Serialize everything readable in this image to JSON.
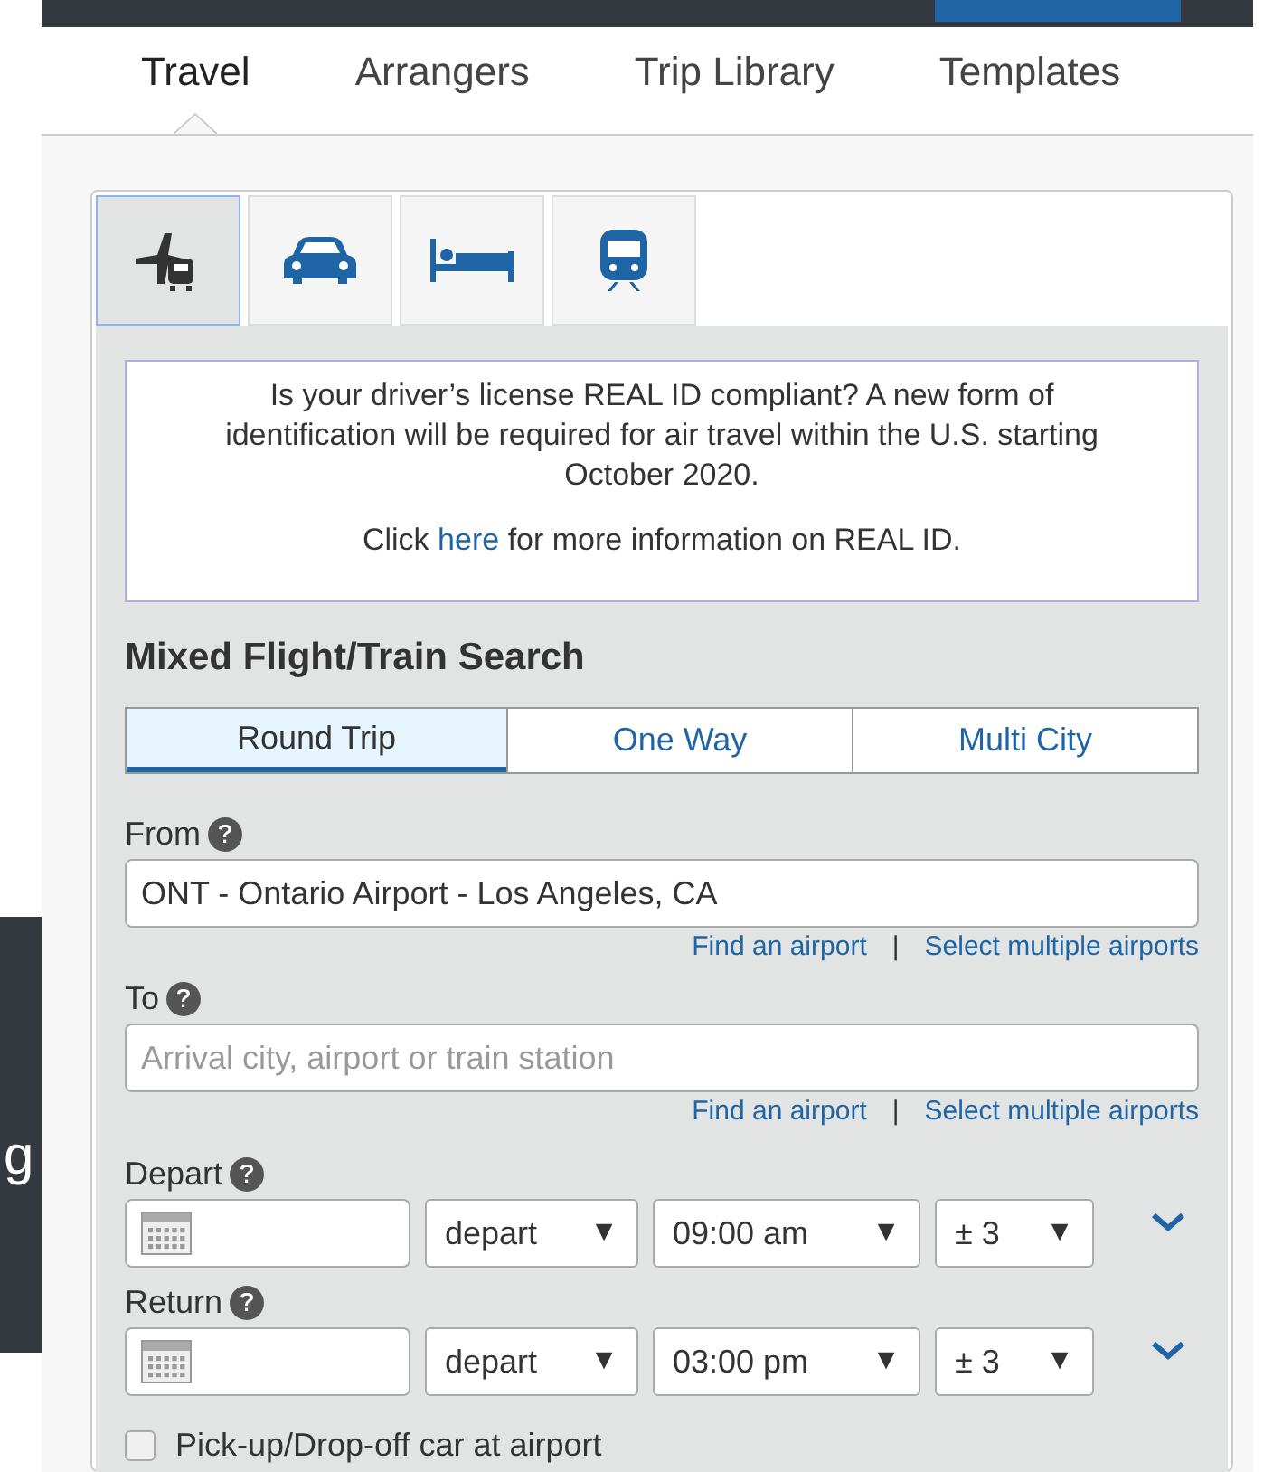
{
  "side_panel": {
    "text": "g"
  },
  "nav_tabs": [
    {
      "label": "Travel",
      "selected": true
    },
    {
      "label": "Arrangers",
      "selected": false
    },
    {
      "label": "Trip Library",
      "selected": false
    },
    {
      "label": "Templates",
      "selected": false
    }
  ],
  "mode_tabs": [
    {
      "kind": "flight-train",
      "selected": true
    },
    {
      "kind": "car",
      "selected": false
    },
    {
      "kind": "hotel",
      "selected": false
    },
    {
      "kind": "train",
      "selected": false
    }
  ],
  "notice": {
    "text": "Is your driver’s license REAL ID compliant? A new form of identification will be required for air travel within the U.S. starting October 2020.",
    "link_before": "Click",
    "link": "here",
    "link_after": "for more information on REAL ID."
  },
  "heading": "Mixed Flight/Train Search",
  "trip_types": [
    {
      "label": "Round Trip",
      "selected": true
    },
    {
      "label": "One Way",
      "selected": false
    },
    {
      "label": "Multi City",
      "selected": false
    }
  ],
  "locations": [
    {
      "label": "From",
      "value": "ONT - Ontario Airport - Los Angeles, CA",
      "links": [
        "Find an airport",
        "Select multiple airports"
      ],
      "separator": "|"
    },
    {
      "label": "To",
      "placeholder": "Arrival city, airport or train station",
      "links": [
        "Find an airport",
        "Select multiple airports"
      ],
      "separator": "|"
    }
  ],
  "dates": [
    {
      "label": "Depart",
      "mode": "depart",
      "time": "09:00 am",
      "window": "± 3"
    },
    {
      "label": "Return",
      "mode": "depart",
      "time": "03:00 pm",
      "window": "± 3"
    }
  ],
  "caret": "▼",
  "car_option": {
    "label": "Pick-up/Drop-off car at airport",
    "checked": false
  }
}
